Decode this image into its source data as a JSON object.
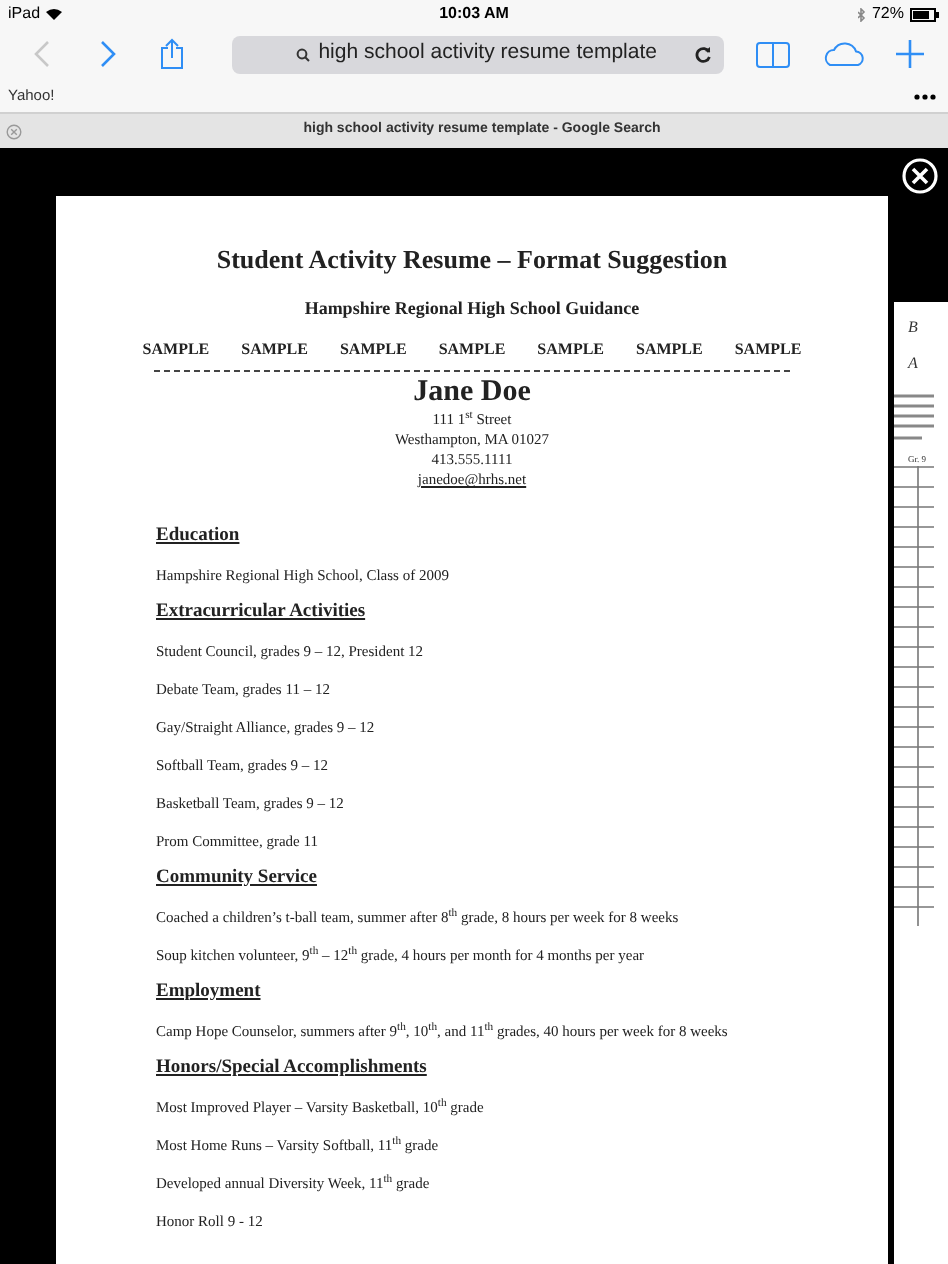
{
  "status_bar": {
    "device": "iPad",
    "time": "10:03 AM",
    "battery": "72%"
  },
  "toolbar": {
    "back_enabled": false,
    "forward_enabled": true,
    "address": "high school activity resume template"
  },
  "bookmarks": [
    "Yahoo!"
  ],
  "tab": {
    "title": "high school activity resume template - Google Search"
  },
  "document": {
    "title": "Student Activity Resume – Format Suggestion",
    "subtitle": "Hampshire Regional High School Guidance",
    "samples": [
      "SAMPLE",
      "SAMPLE",
      "SAMPLE",
      "SAMPLE",
      "SAMPLE",
      "SAMPLE",
      "SAMPLE"
    ],
    "name": "Jane Doe",
    "contact": [
      "111 1$^{st}$ Street",
      "Westhampton, MA  01027",
      "413.555.1111"
    ],
    "email": "janedoe@hrhs.net",
    "sections": [
      {
        "heading": "Education",
        "items": [
          "Hampshire Regional High School, Class of 2009"
        ]
      },
      {
        "heading": "Extracurricular Activities",
        "items": [
          "Student Council, grades 9  – 12, President 12",
          "Debate Team, grades 11 – 12",
          "Gay/Straight Alliance, grades 9 – 12",
          "Softball Team, grades 9 – 12",
          "Basketball Team, grades 9 – 12",
          "Prom Committee, grade 11"
        ]
      },
      {
        "heading": "Community Service",
        "items": [
          "Coached a children’s t-ball team, summer after 8$^{th}$ grade, 8 hours per week for 8 weeks",
          "Soup kitchen volunteer, 9$^{th}$ – 12$^{th}$ grade, 4 hours per month for 4 months per year"
        ]
      },
      {
        "heading": "Employment",
        "items": [
          "Camp Hope Counselor, summers after 9$^{th}$, 10$^{th}$, and 11$^{th}$ grades, 40 hours per week for 8 weeks"
        ]
      },
      {
        "heading": "Honors/Special Accomplishments",
        "items": [
          "Most Improved Player – Varsity Basketball, 10$^{th}$ grade",
          "Most Home Runs – Varsity Softball, 11$^{th}$ grade",
          "Developed annual Diversity Week, 11$^{th}$ grade",
          "Honor Roll 9 - 12"
        ]
      }
    ]
  },
  "next_document": {
    "lines": [
      "B",
      "A"
    ],
    "column_label": "Gr. 9"
  }
}
